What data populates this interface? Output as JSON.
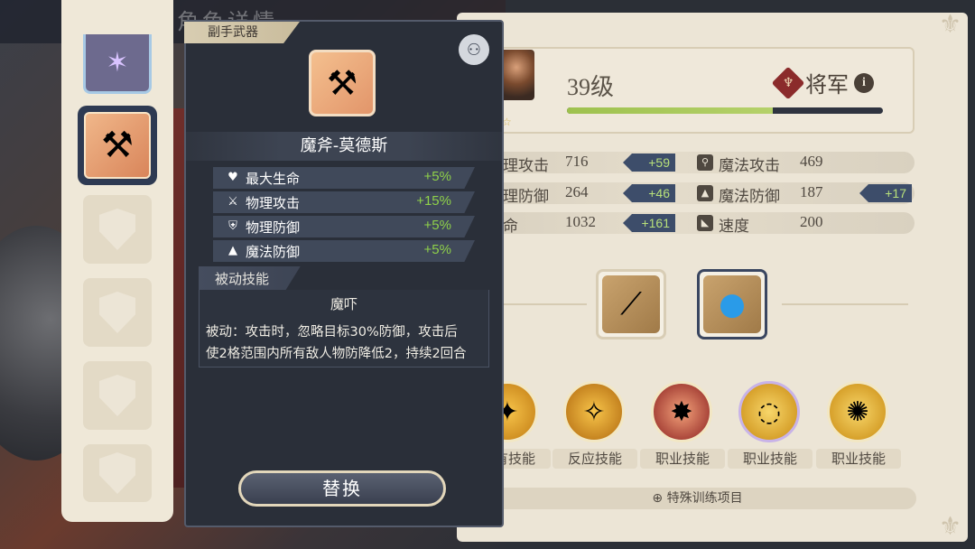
{
  "background": {
    "header_title": "角色详情"
  },
  "popup": {
    "tag": "副手武器",
    "item_name": "魔斧-莫德斯",
    "properties": [
      {
        "icon": "heart-icon",
        "label": "最大生命",
        "value": "+5%"
      },
      {
        "icon": "sword-icon",
        "label": "物理攻击",
        "value": "+15%"
      },
      {
        "icon": "shield-icon",
        "label": "物理防御",
        "value": "+5%"
      },
      {
        "icon": "hat-icon",
        "label": "魔法防御",
        "value": "+5%"
      }
    ],
    "passive_header": "被动技能",
    "skill_name": "魔吓",
    "skill_desc_line1": "被动：攻击时，忽略目标30%防御，攻击后",
    "skill_desc_line2": "使2格范围内所有敌人物防降低2，持续2回合",
    "replace_label": "替换"
  },
  "character": {
    "level": "39级",
    "rank": "将军",
    "exp_fraction": 0.65
  },
  "stats": [
    {
      "label": "物理攻击",
      "value": "716",
      "bonus": "+59"
    },
    {
      "label": "魔法攻击",
      "value": "469",
      "bonus": ""
    },
    {
      "label": "物理防御",
      "value": "264",
      "bonus": "+46"
    },
    {
      "label": "魔法防御",
      "value": "187",
      "bonus": "+17"
    },
    {
      "label": "生命",
      "value": "1032",
      "bonus": "+161"
    },
    {
      "label": "速度",
      "value": "200",
      "bonus": ""
    }
  ],
  "skills": [
    {
      "label": "固有技能"
    },
    {
      "label": "反应技能"
    },
    {
      "label": "职业技能"
    },
    {
      "label": "职业技能"
    },
    {
      "label": "职业技能"
    }
  ],
  "training_label": "特殊训练项目",
  "colors": {
    "bonus_green": "#8fd14a",
    "popup_bg": "#2a2f39",
    "panel_bg": "#ece5d6"
  }
}
